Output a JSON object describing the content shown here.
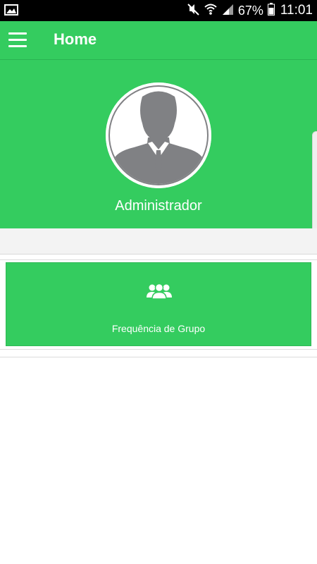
{
  "status_bar": {
    "left_icon": "image-icon",
    "icons": [
      "mute-icon",
      "wifi-icon",
      "signal-icon",
      "battery-icon"
    ],
    "battery": "67%",
    "time": "11:01"
  },
  "app_bar": {
    "menu_icon": "hamburger-menu-icon",
    "title": "Home"
  },
  "profile": {
    "avatar_icon": "user-silhouette-icon",
    "name": "Administrador"
  },
  "cards": [
    {
      "icon": "group-icon",
      "label": "Frequência de Grupo"
    }
  ],
  "colors": {
    "primary": "#34cc5f",
    "status_bar": "#000000",
    "avatar_gray": "#808184",
    "background": "#ffffff"
  }
}
